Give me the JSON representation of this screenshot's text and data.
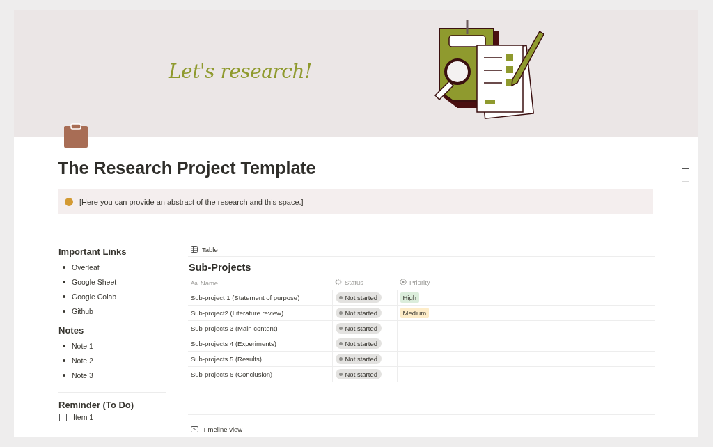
{
  "cover": {
    "tagline": "Let's research!"
  },
  "page": {
    "title": "The Research Project Template"
  },
  "callout": {
    "text": "[Here you can provide an abstract of the research and this space.]"
  },
  "sidebar": {
    "sections": [
      {
        "heading": "Important Links",
        "items": [
          "Overleaf",
          "Google Sheet",
          "Google Colab",
          "Github"
        ]
      },
      {
        "heading": "Notes",
        "items": [
          "Note 1",
          "Note 2",
          "Note 3"
        ]
      }
    ],
    "reminder": {
      "heading": "Reminder (To Do)",
      "items": [
        {
          "label": "Item 1",
          "checked": false
        }
      ]
    }
  },
  "database": {
    "view_tab": "Table",
    "title": "Sub-Projects",
    "name_column_icon": "Aa",
    "columns": [
      "Name",
      "Status",
      "Priority"
    ],
    "rows": [
      {
        "name": "Sub-project 1 (Statement of purpose)",
        "status": "Not started",
        "priority": {
          "label": "High",
          "color": "#dbeddb"
        }
      },
      {
        "name": "Sub-project2 (Literature review)",
        "status": "Not started",
        "priority": {
          "label": "Medium",
          "color": "#fdecc8"
        }
      },
      {
        "name": "Sub-projects 3 (Main content)",
        "status": "Not started"
      },
      {
        "name": "Sub-projects 4 (Experiments)",
        "status": "Not started"
      },
      {
        "name": "Sub-projects 5 (Results)",
        "status": "Not started"
      },
      {
        "name": "Sub-projects 6 (Conclusion)",
        "status": "Not started"
      }
    ]
  },
  "timeline": {
    "view_tab": "Timeline view"
  }
}
